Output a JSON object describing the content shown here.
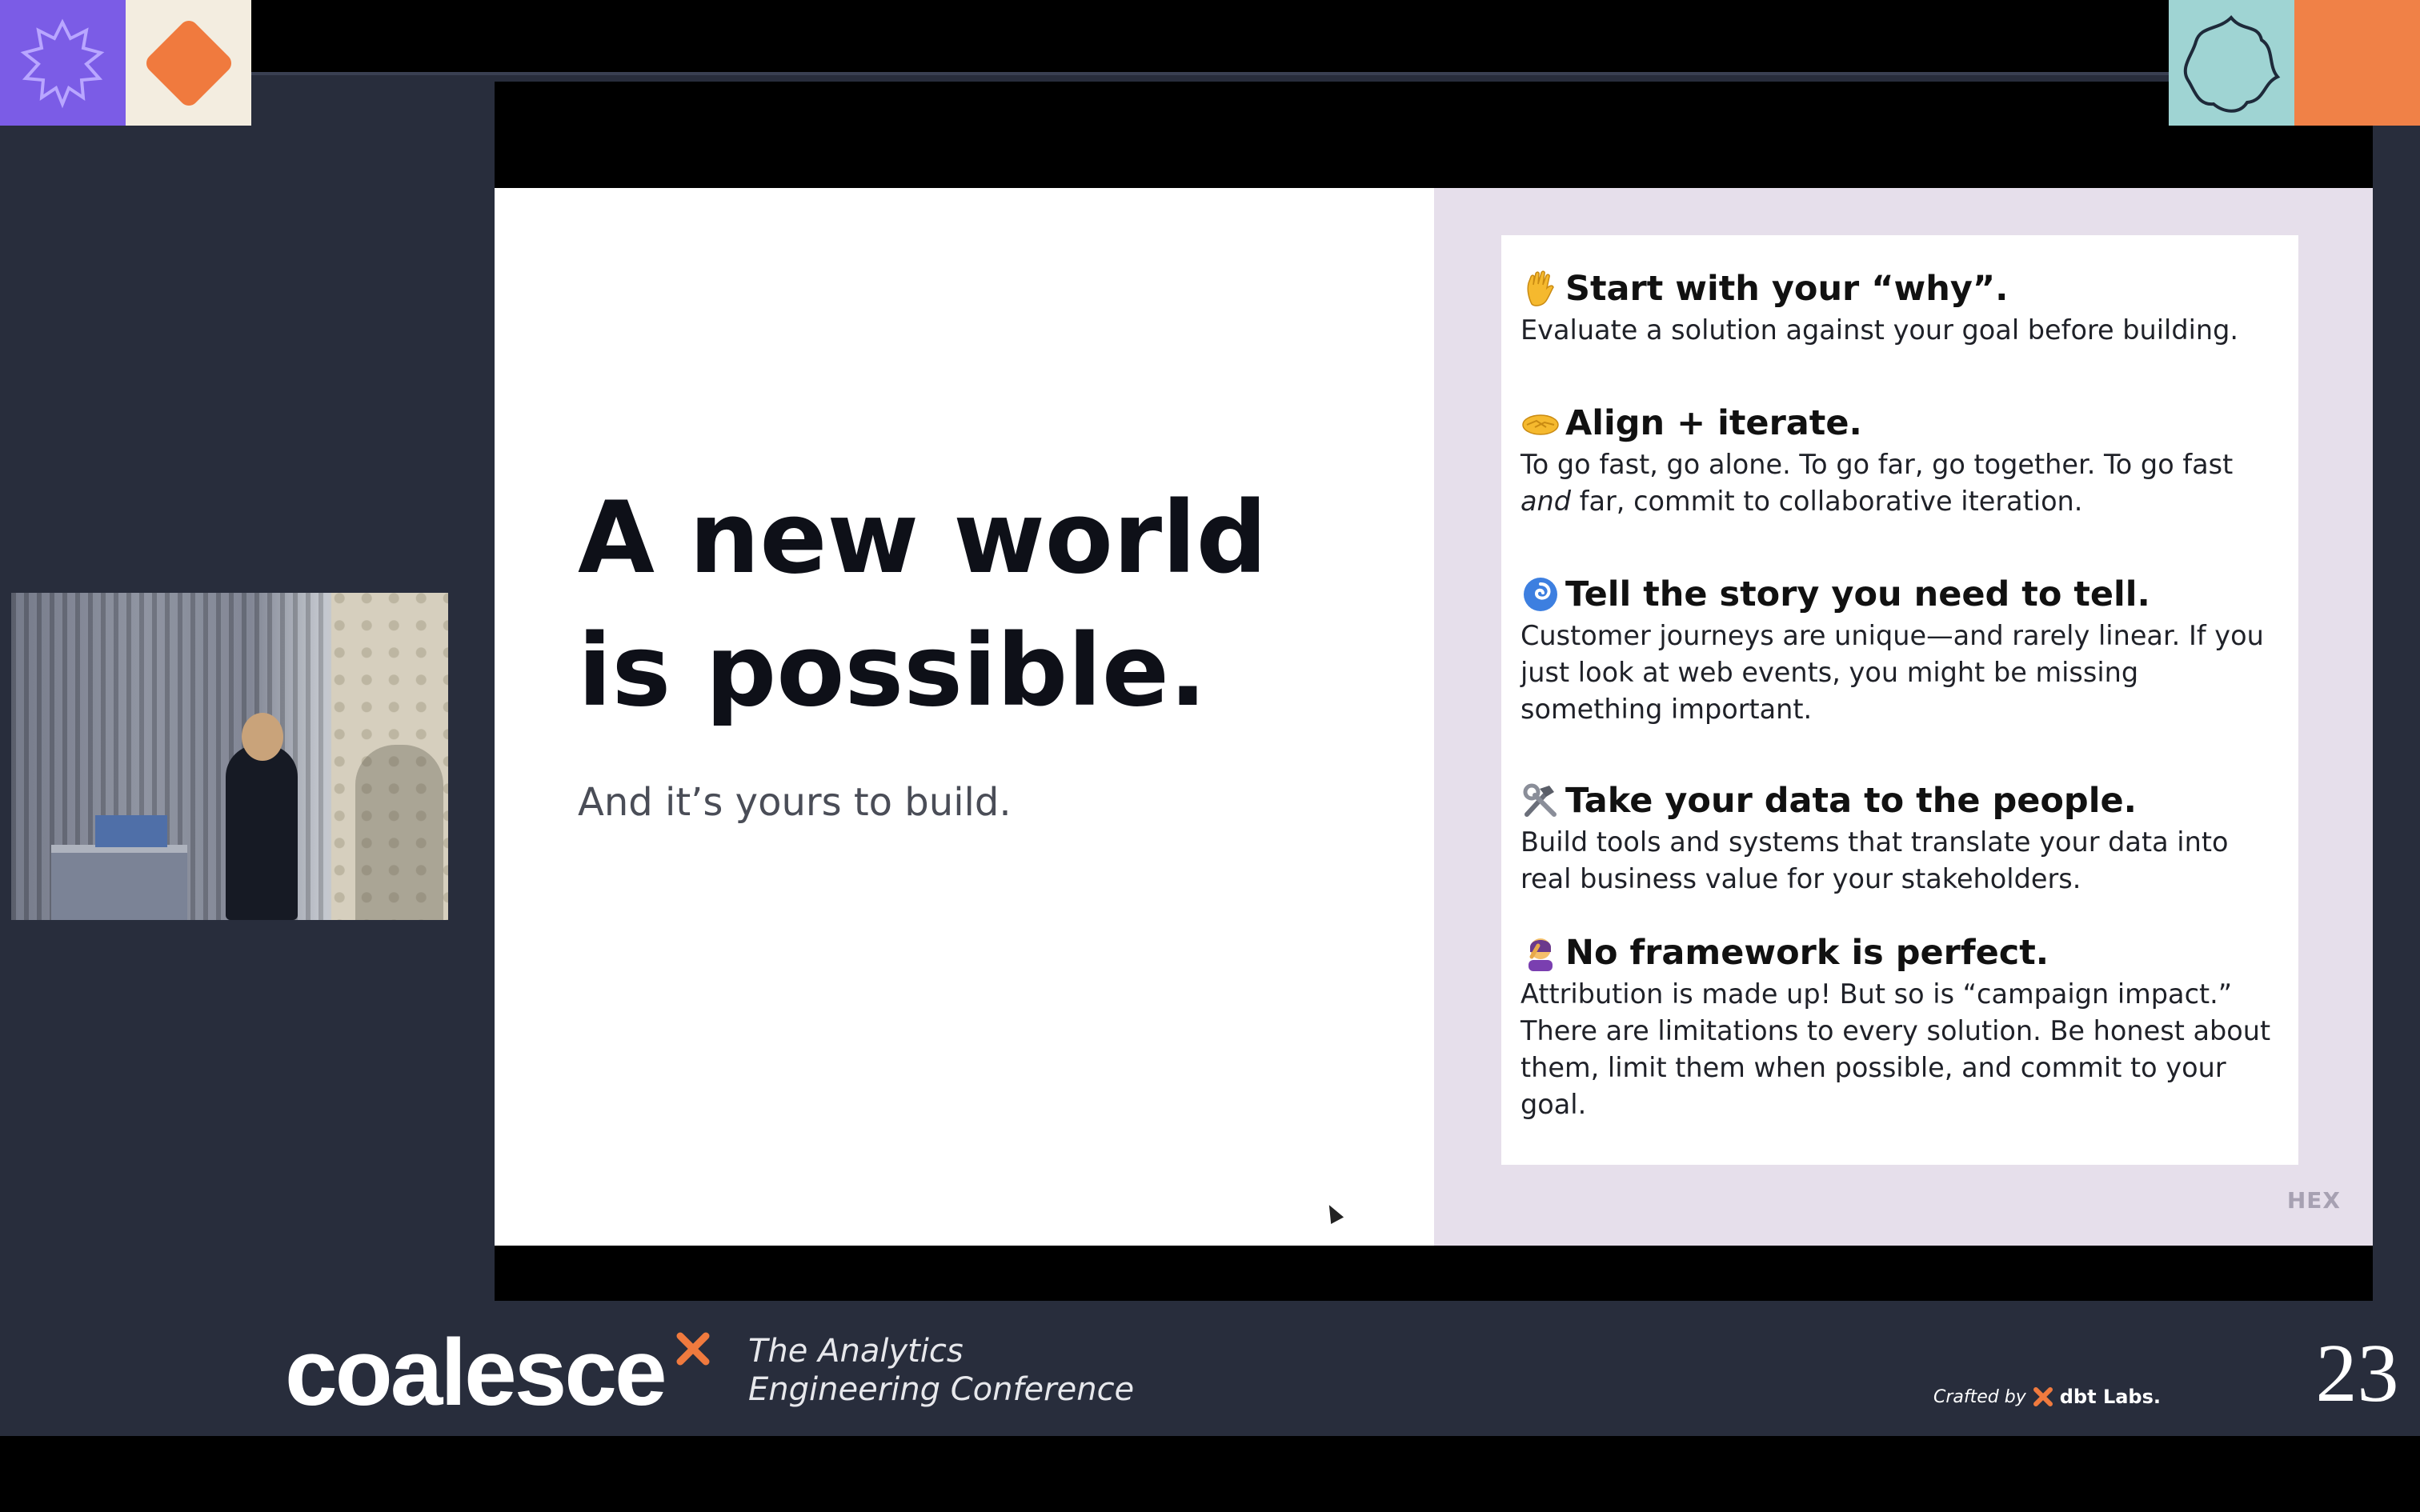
{
  "slide": {
    "headline_line1": "A new world",
    "headline_line2": "is possible.",
    "subline": "And it’s yours to build.",
    "logo": "HEX",
    "items": [
      {
        "icon": "raised-hand-icon",
        "title": "Start with your “why”.",
        "body": "Evaluate a solution against your goal before building."
      },
      {
        "icon": "handshake-icon",
        "title": "Align + iterate.",
        "body_prefix": "To go fast, go alone. To go far, go together. To go fast ",
        "body_emphasis": "and",
        "body_suffix": " far, commit to collaborative iteration."
      },
      {
        "icon": "cyclone-icon",
        "title": "Tell the story you need to tell.",
        "body": "Customer journeys are unique—and rarely linear. If you just look at web events, you might be missing something important."
      },
      {
        "icon": "hammer-wrench-icon",
        "title": "Take your data to the people.",
        "body": "Build tools and systems that translate your data into real business value for your stakeholders."
      },
      {
        "icon": "person-facepalm-icon",
        "title": "No framework is perfect.",
        "body": "Attribution is made up! But so is “campaign impact.” There are limitations to every solution. Be honest about them, limit them when possible, and commit to your goal."
      }
    ]
  },
  "banner": {
    "brand": "coalesce",
    "tagline_line1": "The Analytics",
    "tagline_line2": "Engineering Conference",
    "crafted_label": "Crafted by",
    "crafted_brand": "dbt Labs.",
    "year": "23"
  },
  "colors": {
    "stage_bg": "#282d3c",
    "slide_panel": "#e6dfeb",
    "tile_purple": "#7b5ce6",
    "tile_cream": "#f3ede0",
    "tile_teal": "#9fd4d3",
    "tile_orange": "#f08147"
  }
}
